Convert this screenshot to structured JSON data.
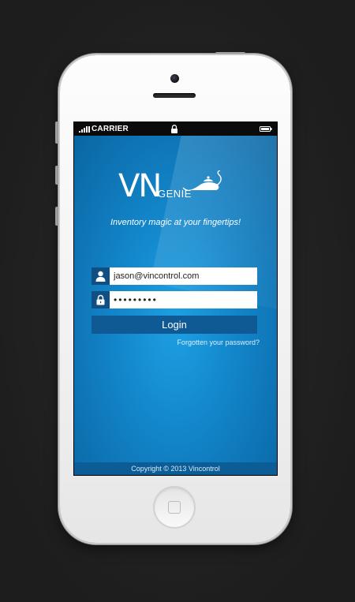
{
  "status_bar": {
    "carrier": "CARRIER"
  },
  "app": {
    "logo": {
      "primary": "VN",
      "secondary": "GENIE"
    },
    "tagline": "Inventory magic at your fingertips!",
    "login_form": {
      "email_value": "jason@vincontrol.com",
      "password_value": "•••••••••",
      "login_label": "Login",
      "forgot_label": "Forgotten your password?"
    },
    "footer": "Copyright © 2013 Vincontrol"
  },
  "colors": {
    "app_blue": "#1284c8",
    "dark_blue": "#0f4f84",
    "button_blue": "#0f5a94"
  }
}
